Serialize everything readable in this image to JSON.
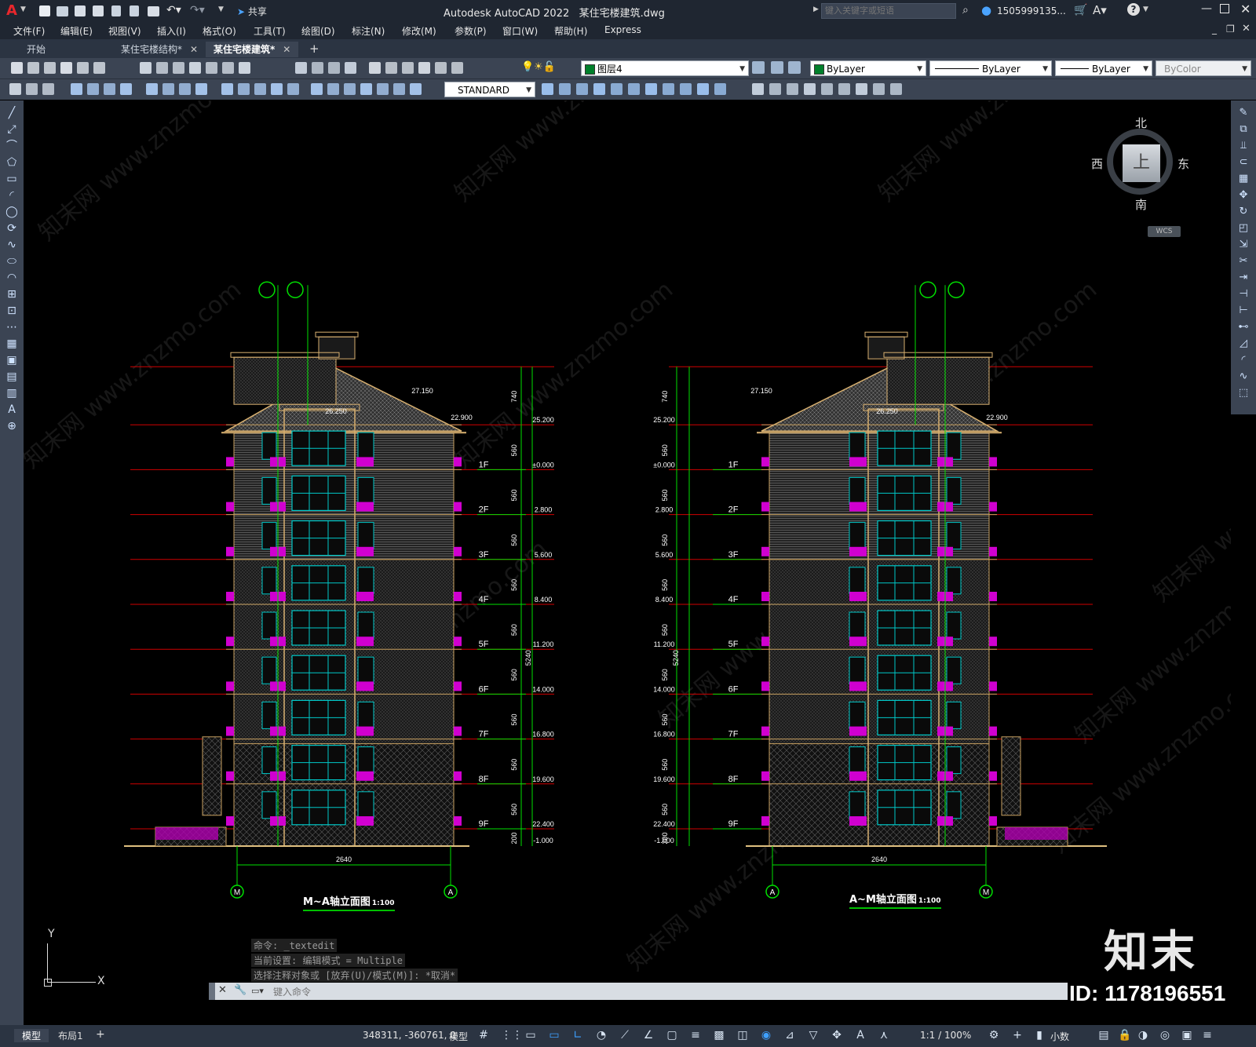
{
  "app": {
    "logo_letter": "A",
    "title": "Autodesk AutoCAD 2022",
    "file_name": "某住宅楼建筑.dwg",
    "search_placeholder": "键入关键字或短语",
    "user": "1505999135...",
    "share_label": "共享"
  },
  "menu": [
    "文件(F)",
    "编辑(E)",
    "视图(V)",
    "插入(I)",
    "格式(O)",
    "工具(T)",
    "绘图(D)",
    "标注(N)",
    "修改(M)",
    "参数(P)",
    "窗口(W)",
    "帮助(H)",
    "Express"
  ],
  "tabs": [
    {
      "label": "开始",
      "active": false,
      "closable": false
    },
    {
      "label": "某住宅楼结构*",
      "active": false,
      "closable": true
    },
    {
      "label": "某住宅楼建筑*",
      "active": true,
      "closable": true
    }
  ],
  "toolbar": {
    "layer_name": "图层4",
    "color": "ByLayer",
    "linetype": "ByLayer",
    "lineweight": "ByLayer",
    "plotstyle": "ByColor",
    "text_style": "STANDARD"
  },
  "viewcube": {
    "north": "北",
    "south": "南",
    "east": "东",
    "west": "西",
    "face": "上",
    "wcs": "WCS"
  },
  "drawing": {
    "left_title": "M~A轴立面图",
    "left_scale": "1:100",
    "right_title": "A~M轴立面图",
    "right_scale": "1:100",
    "width_dim": "2640",
    "total_height": "5240",
    "floor_height": "560",
    "top_dim": "740",
    "base_dim": "200",
    "axis_left_a": "M",
    "axis_left_b": "A",
    "axis_right_a": "A",
    "axis_right_b": "M",
    "ridge_elev": "27.150",
    "ridge_elev2": "26.250",
    "eave_elev": "22.900",
    "floors": [
      {
        "name": "9F",
        "elev": "22.400"
      },
      {
        "name": "8F",
        "elev": "19.600"
      },
      {
        "name": "7F",
        "elev": "16.800"
      },
      {
        "name": "6F",
        "elev": "14.000"
      },
      {
        "name": "5F",
        "elev": "11.200"
      },
      {
        "name": "4F",
        "elev": "8.400"
      },
      {
        "name": "3F",
        "elev": "5.600"
      },
      {
        "name": "2F",
        "elev": "2.800"
      },
      {
        "name": "1F",
        "elev": "±0.000"
      }
    ],
    "top_elev": "25.200",
    "bottom_elev": "-1.000"
  },
  "command": {
    "history": [
      "命令: _textedit",
      "当前设置: 编辑模式 = Multiple",
      "选择注释对象或 [放弃(U)/模式(M)]: *取消*"
    ],
    "placeholder": "键入命令"
  },
  "ucs": {
    "x": "X",
    "y": "Y"
  },
  "status": {
    "tab_model": "模型",
    "tab_layout": "布局1",
    "coords": "348311, -360761, 0",
    "mode": "模型",
    "scale": "1:1 / 100%",
    "units": "小数"
  },
  "watermark": {
    "brand": "知末",
    "id_text": "ID: 1178196551",
    "url": "知末网 www.znzmo.com"
  }
}
